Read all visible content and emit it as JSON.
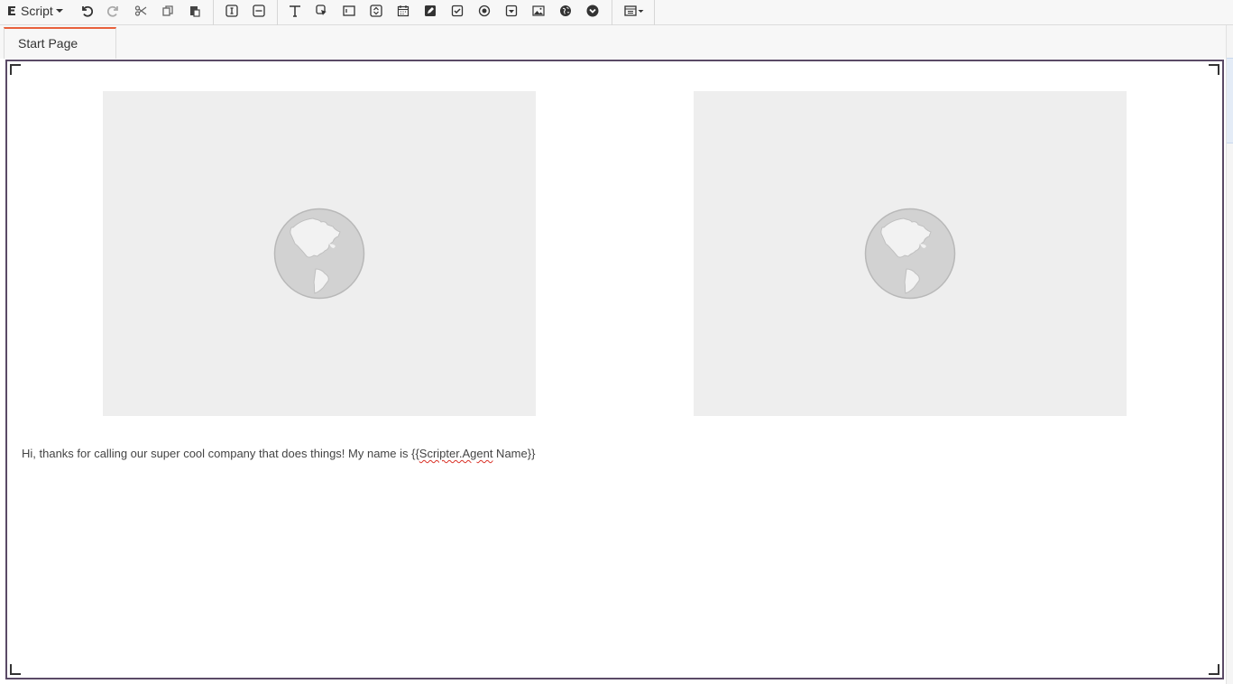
{
  "toolbar": {
    "script_menu_label": "Script",
    "buttons": [
      {
        "name": "undo-icon"
      },
      {
        "name": "redo-icon"
      },
      {
        "name": "cut-icon"
      },
      {
        "name": "copy-icon"
      },
      {
        "name": "paste-icon"
      },
      {
        "name": "text-cursor-icon"
      },
      {
        "name": "horizontal-rule-icon"
      },
      {
        "name": "text-icon"
      },
      {
        "name": "button-pointer-icon"
      },
      {
        "name": "textbox-icon"
      },
      {
        "name": "spinner-icon"
      },
      {
        "name": "calendar-icon"
      },
      {
        "name": "multiline-edit-icon"
      },
      {
        "name": "checkbox-icon"
      },
      {
        "name": "radio-icon"
      },
      {
        "name": "dropdown-icon"
      },
      {
        "name": "image-icon"
      },
      {
        "name": "globe-icon"
      },
      {
        "name": "chevron-circle-icon"
      },
      {
        "name": "layout-menu-icon"
      }
    ]
  },
  "tabs": [
    {
      "label": "Start Page",
      "active": true
    }
  ],
  "canvas": {
    "image_placeholders": [
      {
        "icon": "globe-placeholder-icon"
      },
      {
        "icon": "globe-placeholder-icon"
      }
    ],
    "script_text_before": "Hi, thanks for calling our super cool company that does things! My name is {{",
    "script_variable": "Scripter.Agent",
    "script_text_after": " Name}}"
  },
  "colors": {
    "tab_accent": "#e8603c",
    "canvas_border": "#5a4a66",
    "placeholder_bg": "#eeeeee",
    "globe": "#d0d0d0"
  }
}
